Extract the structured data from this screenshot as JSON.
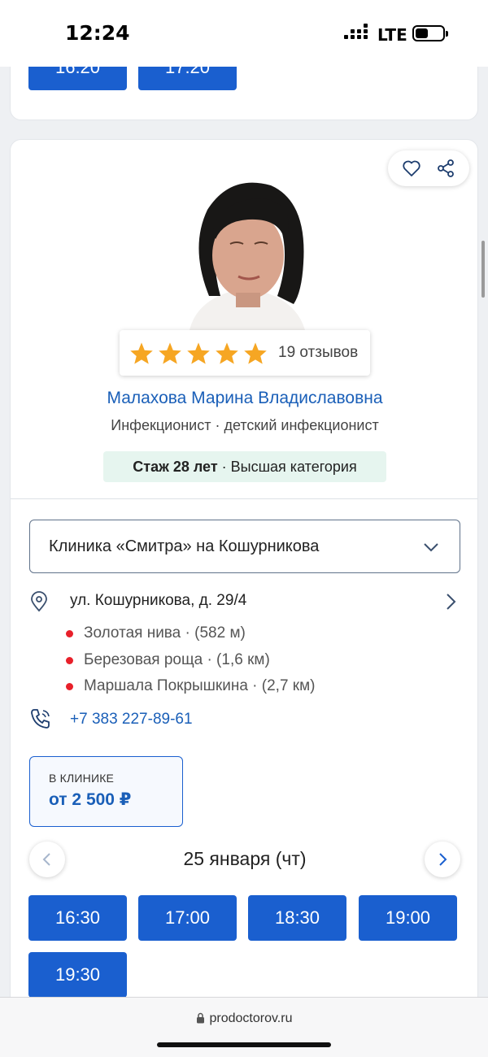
{
  "status_bar": {
    "time": "12:24",
    "network": "LTE"
  },
  "prev_card": {
    "slots": [
      "16:20",
      "17:20"
    ]
  },
  "doctor": {
    "name": "Малахова Марина Владиславовна",
    "specialty": "Инфекционист · детский инфекционист",
    "experience": "Стаж 28 лет",
    "category": " · Высшая категория",
    "rating_stars": 5,
    "reviews": "19 отзывов"
  },
  "clinic": {
    "selected": "Клиника «Смитра» на Кошурникова",
    "address": "ул. Кошурникова, д. 29/4",
    "metro": [
      "Золотая нива · (582 м)",
      "Березовая роща · (1,6 км)",
      "Маршала Покрышкина · (2,7 км)"
    ],
    "phone": "+7 383 227-89-61"
  },
  "price": {
    "label": "В КЛИНИКЕ",
    "value": "от 2 500 ₽"
  },
  "schedule": {
    "date": "25 января (чт)",
    "slots": [
      "16:30",
      "17:00",
      "18:30",
      "19:00",
      "19:30"
    ]
  },
  "browser": {
    "url": "prodoctorov.ru"
  },
  "colors": {
    "accent": "#1a5fcf",
    "link": "#1a5fb8",
    "star": "#f6a623",
    "metro": "#e8202a",
    "badge_bg": "#e6f5ef"
  },
  "icons": [
    "heart-icon",
    "share-icon",
    "star-icon",
    "chevron-down-icon",
    "map-pin-icon",
    "chevron-right-icon",
    "phone-icon",
    "chevron-left-icon",
    "lock-icon"
  ]
}
